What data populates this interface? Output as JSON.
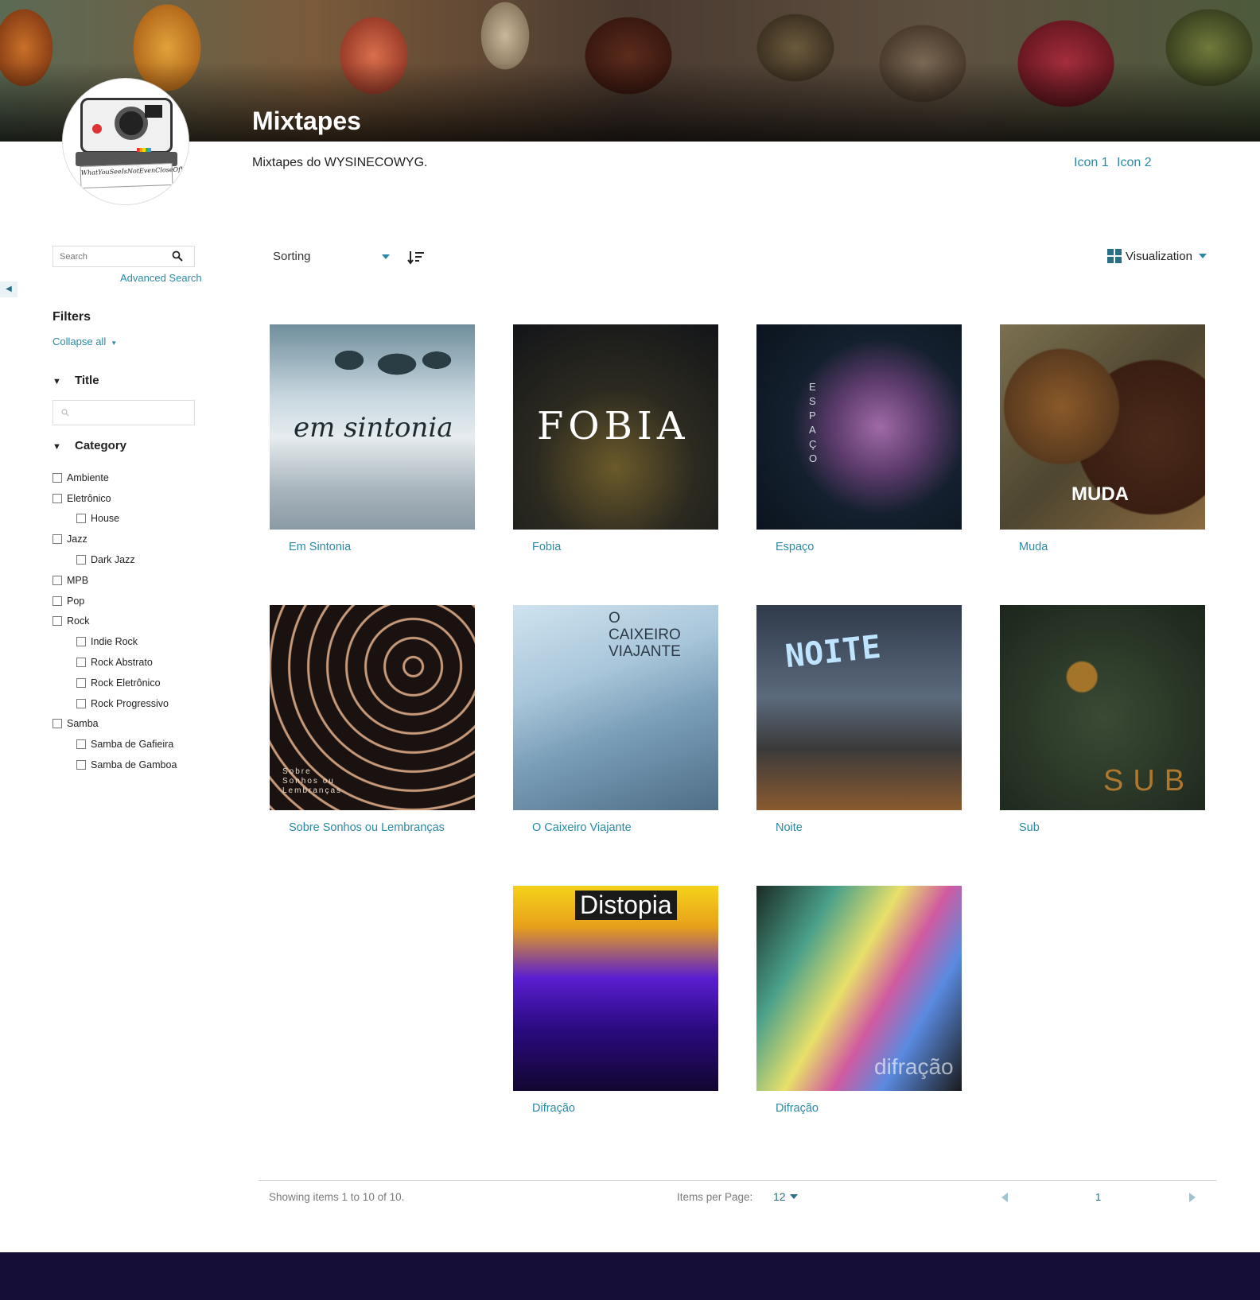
{
  "header": {
    "title": "Mixtapes",
    "description": "Mixtapes do WYSINECOWYG.",
    "links": [
      "Icon 1",
      "Icon 2"
    ],
    "logo_text": "WhatYouSeeIsNotEvenCloseOfWhatYouGet"
  },
  "sidebar": {
    "search_placeholder": "Search",
    "advanced_search": "Advanced Search",
    "filters_title": "Filters",
    "collapse_all": "Collapse all",
    "facets": {
      "title_label": "Title",
      "category_label": "Category"
    },
    "categories": [
      {
        "label": "Ambiente",
        "level": 0
      },
      {
        "label": "Eletrônico",
        "level": 0
      },
      {
        "label": "House",
        "level": 1
      },
      {
        "label": "Jazz",
        "level": 0
      },
      {
        "label": "Dark Jazz",
        "level": 1
      },
      {
        "label": "MPB",
        "level": 0
      },
      {
        "label": "Pop",
        "level": 0
      },
      {
        "label": "Rock",
        "level": 0
      },
      {
        "label": "Indie Rock",
        "level": 1
      },
      {
        "label": "Rock Abstrato",
        "level": 1
      },
      {
        "label": "Rock Eletrônico",
        "level": 1
      },
      {
        "label": "Rock Progressivo",
        "level": 1
      },
      {
        "label": "Samba",
        "level": 0
      },
      {
        "label": "Samba de Gafieira",
        "level": 1
      },
      {
        "label": "Samba de Gamboa",
        "level": 1
      }
    ]
  },
  "toolbar": {
    "sorting_label": "Sorting",
    "visualization_label": "Visualization"
  },
  "items": [
    {
      "title": "Em Sintonia",
      "cover_text": "em sintonia"
    },
    {
      "title": "Fobia",
      "cover_text": "FOBIA"
    },
    {
      "title": "Espaço",
      "cover_text": "ESPAÇO"
    },
    {
      "title": "Muda",
      "cover_text": "MUDA"
    },
    {
      "title": "Sobre Sonhos ou Lembranças",
      "cover_text": "Sobre Sonhos ou Lembranças"
    },
    {
      "title": "O Caixeiro Viajante",
      "cover_text": "O CAIXEIRO VIAJANTE"
    },
    {
      "title": "Noite",
      "cover_text": "NOITE"
    },
    {
      "title": "Sub",
      "cover_text": "SUB"
    },
    {
      "title": "Difração",
      "cover_text": "Distopia"
    },
    {
      "title": "Difração",
      "cover_text": "difração"
    }
  ],
  "pagination": {
    "showing": "Showing items 1 to 10 of 10.",
    "items_per_page_label": "Items per Page:",
    "items_per_page_value": "12",
    "current_page": "1"
  },
  "colors": {
    "accent": "#2a8aa5",
    "footer": "#150e36"
  }
}
